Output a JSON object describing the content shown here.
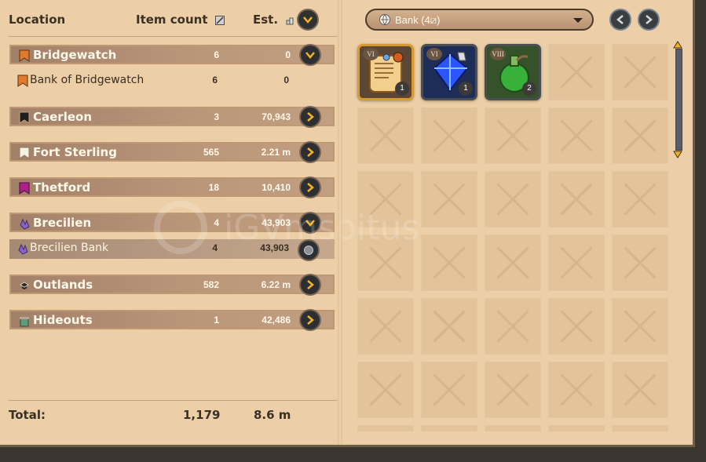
{
  "header": {
    "location": "Location",
    "item_count": "Item count",
    "est": "Est."
  },
  "locations": [
    {
      "name": "Bridgewatch",
      "count": "6",
      "value": "0",
      "marker_color": "#e07b2c",
      "expanded": true
    },
    {
      "name": "Bank of Bridgewatch",
      "count": "6",
      "value": "0",
      "marker_color": "#e07b2c",
      "sub": true
    },
    {
      "name": "Caerleon",
      "count": "3",
      "value": "70,943",
      "marker_color": "#1f1f1f"
    },
    {
      "name": "Fort Sterling",
      "count": "565",
      "value": "2.21 m",
      "marker_color": "#f2f2ea"
    },
    {
      "name": "Thetford",
      "count": "18",
      "value": "10,410",
      "marker_color": "#b0208a"
    },
    {
      "name": "Brecilien",
      "count": "4",
      "value": "43,903",
      "marker_color": "#8a62c8",
      "expanded": true
    },
    {
      "name": "Brecilien Bank",
      "count": "4",
      "value": "43,903",
      "marker_color": "#8a62c8",
      "sub": true
    },
    {
      "name": "Outlands",
      "count": "582",
      "value": "6.22 m",
      "marker_color": "#2d2a24"
    },
    {
      "name": "Hideouts",
      "count": "1",
      "value": "42,486",
      "marker_color": "#5f9b7d"
    }
  ],
  "total": {
    "label": "Total:",
    "count": "1,179",
    "value": "8.6 m"
  },
  "bank_select": {
    "label": "Bank (4⧄)"
  },
  "items": [
    {
      "name": "scroll-item",
      "tier": "VI",
      "qty": "1"
    },
    {
      "name": "crystal-item",
      "tier": "VI",
      "qty": "1"
    },
    {
      "name": "potion-item",
      "tier": "VIII",
      "qty": "2"
    }
  ],
  "colors": {
    "accent_gold": "#f4b323",
    "button_dark": "#2d2f32"
  },
  "watermark_text": "iGVmsoitus"
}
